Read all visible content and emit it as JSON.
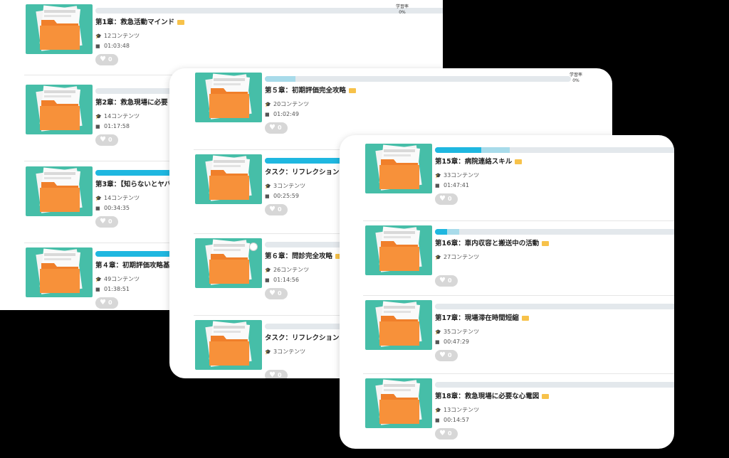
{
  "learning_rate_label": "学習率",
  "icons": {
    "contents": "graduation-cap-icon",
    "duration": "video-camera-icon",
    "like": "heart-icon",
    "category": "folder-icon"
  },
  "colors": {
    "thumbnail_bg": "#46bea8",
    "folder": "#f7913a",
    "progress_done": "#1fb7e0",
    "progress_partial": "#a8dbea",
    "progress_track": "#e3e8ec"
  },
  "panels": [
    {
      "items": [
        {
          "title": "第1章：救急活動マインド",
          "contents": "12コンテンツ",
          "duration": "01:03:48",
          "likes": "0",
          "rate": "0%",
          "progress": 0,
          "done": 0
        },
        {
          "title": "第2章：救急現場に必要",
          "contents": "14コンテンツ",
          "duration": "01:17:58",
          "likes": "0",
          "progress": 0,
          "done": 0
        },
        {
          "title": "第3章：【知らないとヤバ",
          "contents": "14コンテンツ",
          "duration": "00:34:35",
          "likes": "0",
          "progress": 0.7,
          "done": 0.3
        },
        {
          "title": "第４章：初期評価攻略基",
          "contents": "49コンテンツ",
          "duration": "01:38:51",
          "likes": "0",
          "progress": 0.7,
          "done": 0.6
        }
      ]
    },
    {
      "items": [
        {
          "title": "第５章：初期評価完全攻略",
          "contents": "20コンテンツ",
          "duration": "01:02:49",
          "likes": "0",
          "rate": "0%",
          "progress": 0.1,
          "done": 0
        },
        {
          "title": "タスク：リフレクション",
          "contents": "3コンテンツ",
          "duration": "00:25:59",
          "likes": "0",
          "progress": 1.0,
          "done": 1.0
        },
        {
          "title": "第６章：問診完全攻略",
          "contents": "26コンテンツ",
          "duration": "01:14:56",
          "likes": "0",
          "progress": 0,
          "done": 0
        },
        {
          "title": "タスク：リフレクション",
          "contents": "3コンテンツ",
          "duration": "",
          "likes": "0",
          "progress": 0,
          "done": 0
        }
      ]
    },
    {
      "items": [
        {
          "title": "第15章：病院連絡スキル",
          "contents": "33コンテンツ",
          "duration": "01:47:41",
          "likes": "0",
          "progress": 0.31,
          "done": 0.19
        },
        {
          "title": "第16章：車内収容と搬送中の活動",
          "contents": "27コンテンツ",
          "duration": "",
          "likes": "0",
          "progress": 0.1,
          "done": 0.05
        },
        {
          "title": "第17章：現場滞在時間短縮",
          "contents": "35コンテンツ",
          "duration": "00:47:29",
          "likes": "0",
          "progress": 0,
          "done": 0
        },
        {
          "title": "第18章：救急現場に必要な心電図",
          "contents": "13コンテンツ",
          "duration": "00:14:57",
          "likes": "0",
          "progress": 0,
          "done": 0
        }
      ]
    }
  ]
}
